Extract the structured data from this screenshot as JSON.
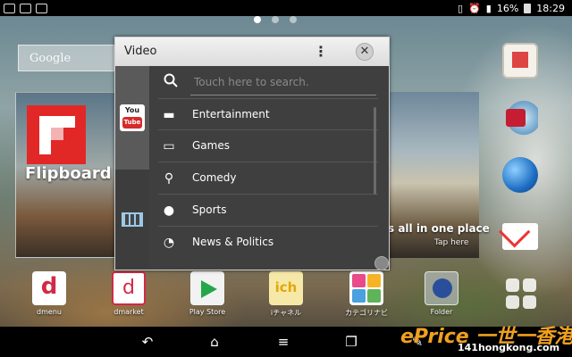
{
  "status_bar": {
    "battery": "16%",
    "time": "18:29"
  },
  "home": {
    "google_widget_label": "Google",
    "flipboard_label": "Flipboard",
    "right_card": {
      "headline": "s all in one place",
      "subtext": "Tap here"
    },
    "dock": [
      {
        "label": "dmenu"
      },
      {
        "label": "dmarket"
      },
      {
        "label": "Play Store"
      },
      {
        "label": "iチャネル"
      },
      {
        "label": "カテゴリナビ"
      },
      {
        "label": "Folder"
      }
    ]
  },
  "widget": {
    "title": "Video",
    "menu_glyph": "⋮",
    "close_glyph": "✕",
    "side_tabs": [
      {
        "label": "You",
        "label2": "Tube"
      }
    ],
    "search_placeholder": "Touch here to search.",
    "items": [
      {
        "label": "Entertainment",
        "icon": "clapper-icon"
      },
      {
        "label": "Games",
        "icon": "gamepad-icon"
      },
      {
        "label": "Comedy",
        "icon": "microphone-icon"
      },
      {
        "label": "Sports",
        "icon": "soccer-ball-icon"
      },
      {
        "label": "News & Politics",
        "icon": "rss-icon"
      }
    ]
  },
  "nav": {
    "back": "↶",
    "home": "⌂",
    "menu": "≡",
    "recent": "❐",
    "edit": "✎"
  },
  "watermark": {
    "main": "ePrice 一世一香港",
    "sub": "141hongkong.com"
  },
  "colors": {
    "widget_bg": "#3f3f3f",
    "youtube_red": "#d52b2b",
    "flipboard_red": "#e12827"
  }
}
